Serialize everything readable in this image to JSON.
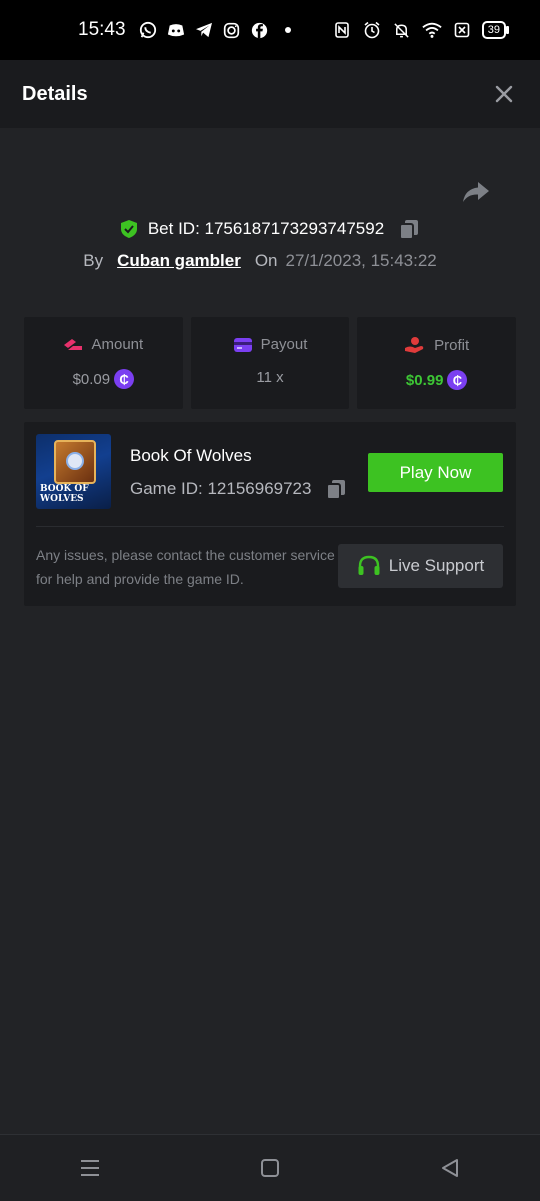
{
  "status_bar": {
    "time": "15:43",
    "battery": "39",
    "app_icons": [
      "whatsapp-icon",
      "discord-icon",
      "telegram-icon",
      "instagram-icon",
      "facebook-icon",
      "dot-icon"
    ],
    "system_icons": [
      "nfc-icon",
      "alarm-icon",
      "mute-icon",
      "wifi-icon",
      "sim-icon"
    ]
  },
  "header": {
    "title": "Details"
  },
  "bet": {
    "label": "Bet ID: 1756187173293747592",
    "by_label": "By",
    "user": "Cuban gambler",
    "on_label": "On",
    "date": "27/1/2023, 15:43:22"
  },
  "stats": [
    {
      "label": "Amount",
      "value": "$0.09",
      "icon": "amount-icon",
      "color": "#e8316c"
    },
    {
      "label": "Payout",
      "value": "11 x",
      "icon": "payout-icon",
      "color": "#7b3ff1"
    },
    {
      "label": "Profit",
      "value": "$0.99",
      "icon": "profit-icon",
      "color": "#e03b3b"
    }
  ],
  "game": {
    "name": "Book Of Wolves",
    "id_label": "Game ID: 12156969723",
    "thumb_title": "BOOK OF WOLVES",
    "play_label": "Play Now",
    "help_text": "Any issues, please contact the customer service for help and provide the game ID.",
    "support_label": "Live Support"
  },
  "colors": {
    "accent_green": "#3dc222",
    "coin": "#7b3ff1",
    "background": "#222326"
  }
}
